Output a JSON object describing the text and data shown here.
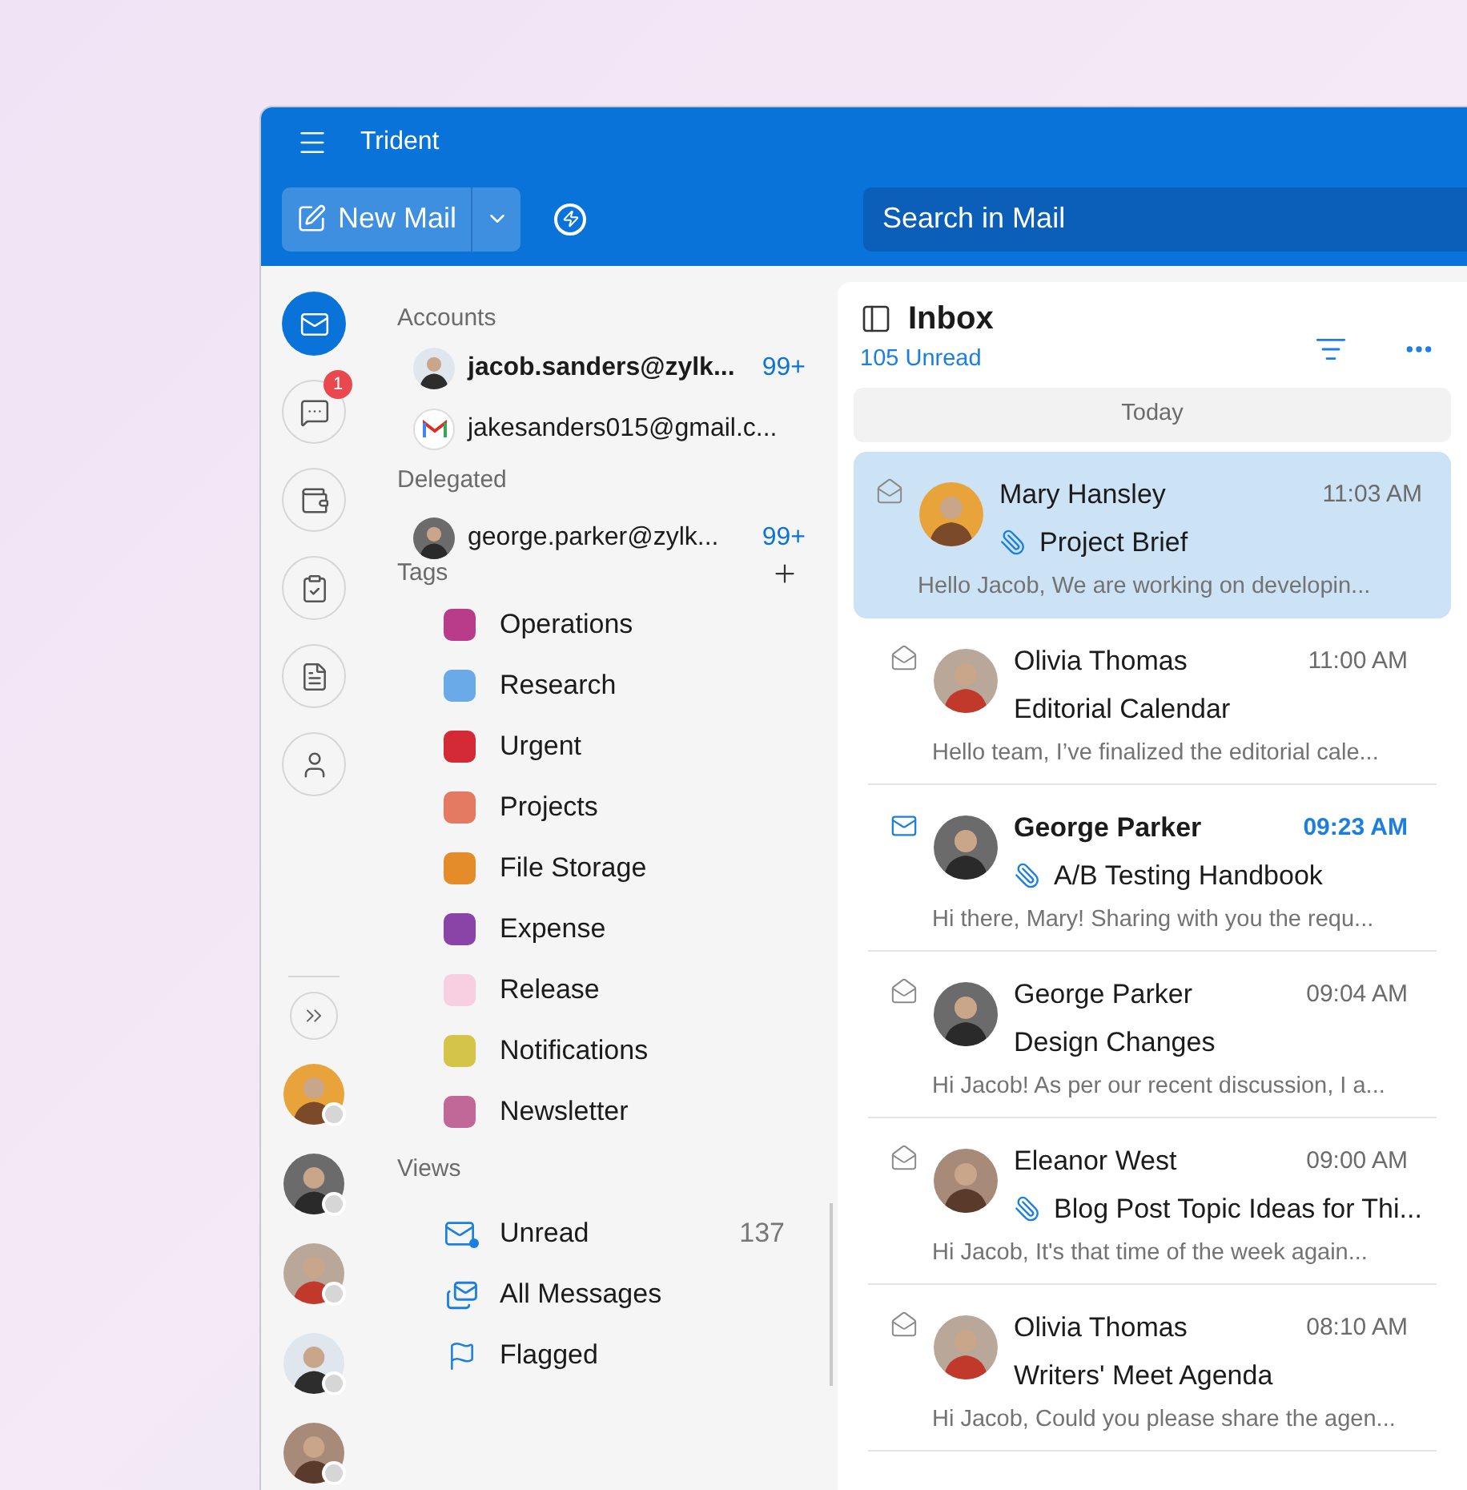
{
  "app": {
    "title": "Trident"
  },
  "toolbar": {
    "new_mail": "New Mail",
    "search": {
      "placeholder": "Search in Mail"
    }
  },
  "rail": {
    "items": [
      {
        "selected": true
      },
      {
        "selected": false,
        "badge": "1"
      },
      {
        "selected": false
      },
      {
        "selected": false
      },
      {
        "selected": false
      },
      {
        "selected": false
      }
    ]
  },
  "folders": {
    "accounts_heading": "Accounts",
    "accounts": [
      {
        "kind": "photo",
        "name": "jacob.sanders@zylk...",
        "count": "99+",
        "selected": true
      },
      {
        "kind": "gmail",
        "name": "jakesanders015@gmail.c...",
        "selected": false
      }
    ],
    "delegated_heading": "Delegated",
    "delegated": [
      {
        "kind": "photo",
        "name": "george.parker@zylk...",
        "count": "99+",
        "selected": false
      }
    ],
    "tags_heading": "Tags",
    "tags": [
      {
        "label": "Operations",
        "color": "#b83c8a"
      },
      {
        "label": "Research",
        "color": "#6aaae8"
      },
      {
        "label": "Urgent",
        "color": "#d42a35"
      },
      {
        "label": "Projects",
        "color": "#e57a62"
      },
      {
        "label": "File Storage",
        "color": "#e48c2a"
      },
      {
        "label": "Expense",
        "color": "#8a44a8"
      },
      {
        "label": "Release",
        "color": "#f7cfe0"
      },
      {
        "label": "Notifications",
        "color": "#d4c44a"
      },
      {
        "label": "Newsletter",
        "color": "#c06898"
      }
    ],
    "views_heading": "Views",
    "views": [
      {
        "label": "Unread",
        "count": "137"
      },
      {
        "label": "All Messages"
      },
      {
        "label": "Flagged"
      }
    ]
  },
  "inbox": {
    "title": "Inbox",
    "unread": "105 Unread",
    "group": "Today",
    "messages": [
      {
        "sender": "Mary Hansley",
        "time": "11:03 AM",
        "subject": "Project Brief",
        "preview": "Hello Jacob, We are working on developin...",
        "unread": false,
        "attachment": true,
        "selected": true
      },
      {
        "sender": "Olivia Thomas",
        "time": "11:00 AM",
        "subject": "Editorial Calendar",
        "preview": "Hello team, I’ve finalized the editorial cale...",
        "unread": false,
        "attachment": false,
        "selected": false
      },
      {
        "sender": "George Parker",
        "time": "09:23 AM",
        "subject": "A/B Testing Handbook",
        "preview": "Hi there, Mary! Sharing with you the requ...",
        "unread": true,
        "attachment": true,
        "selected": false
      },
      {
        "sender": "George Parker",
        "time": "09:04 AM",
        "subject": "Design Changes",
        "preview": "Hi Jacob! As per our recent discussion, I a...",
        "unread": false,
        "attachment": false,
        "selected": false
      },
      {
        "sender": "Eleanor West",
        "time": "09:00 AM",
        "subject": "Blog Post Topic Ideas for Thi...",
        "preview": "Hi Jacob, It's that time of the week again...",
        "unread": false,
        "attachment": true,
        "selected": false
      },
      {
        "sender": "Olivia Thomas",
        "time": "08:10 AM",
        "subject": "Writers' Meet Agenda",
        "preview": "Hi Jacob, Could you please share the agen...",
        "unread": false,
        "attachment": false,
        "selected": false
      }
    ]
  }
}
